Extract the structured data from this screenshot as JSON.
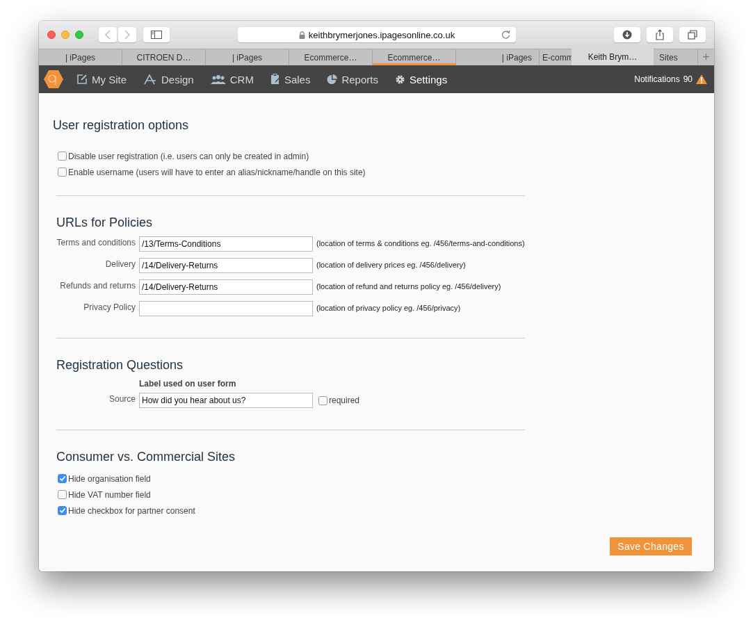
{
  "browser": {
    "address": "keithbrymerjones.ipagesonline.co.uk",
    "tabs": [
      {
        "label": "| iPages",
        "selected": false
      },
      {
        "label": "CITROEN D…",
        "selected": false
      },
      {
        "label": "| iPages",
        "selected": false
      },
      {
        "label": "Ecommerce…",
        "selected": false
      },
      {
        "label": "Ecommerce…",
        "selected": true
      },
      {
        "label": "| iPages",
        "selected": false
      },
      {
        "label": "E-comm",
        "selected": false
      },
      {
        "label": "Sites",
        "selected": false
      }
    ],
    "dragged_tab": "Keith Brym…",
    "new_tab": "+"
  },
  "nav": {
    "items": [
      {
        "label": "My Site",
        "selected": false
      },
      {
        "label": "Design",
        "selected": false
      },
      {
        "label": "CRM",
        "selected": false
      },
      {
        "label": "Sales",
        "selected": false
      },
      {
        "label": "Reports",
        "selected": false
      },
      {
        "label": "Settings",
        "selected": true
      }
    ],
    "notifications": {
      "label": "Notifications",
      "count": "90"
    }
  },
  "sections": [
    {
      "title": "User registration options",
      "kind": "checkboxes",
      "items": [
        {
          "label": "Disable user registration (i.e. users can only be created in admin)",
          "checked": false
        },
        {
          "label": "Enable username (users will have to enter an alias/nickname/handle on this site)",
          "checked": false
        }
      ]
    },
    {
      "title": "URLs for Policies",
      "kind": "fields",
      "rows": [
        {
          "label": "Terms and conditions",
          "value": "/13/Terms-Conditions",
          "hint": "(location of terms & conditions eg. /456/terms-and-conditions)"
        },
        {
          "label": "Delivery",
          "value": "/14/Delivery-Returns",
          "hint": "(location of delivery prices eg. /456/delivery)"
        },
        {
          "label": "Refunds and returns",
          "value": "/14/Delivery-Returns",
          "hint": "(location of refund and returns policy eg. /456/delivery)"
        },
        {
          "label": "Privacy Policy",
          "hint": "(location of privacy policy eg. /456/privacy)"
        }
      ]
    },
    {
      "title": "Registration Questions",
      "kind": "questions",
      "column_heading": "Label used on user form",
      "rows": [
        {
          "label": "Source",
          "value": "How did you hear about us?",
          "required_label": "required",
          "required": false
        }
      ]
    },
    {
      "title": "Consumer vs. Commercial Sites",
      "kind": "checkboxes",
      "items": [
        {
          "label": "Hide organisation field",
          "checked": true
        },
        {
          "label": "Hide VAT number field",
          "checked": false
        },
        {
          "label": "Hide checkbox for partner consent",
          "checked": true
        }
      ]
    }
  ],
  "save_button": "Save Changes"
}
